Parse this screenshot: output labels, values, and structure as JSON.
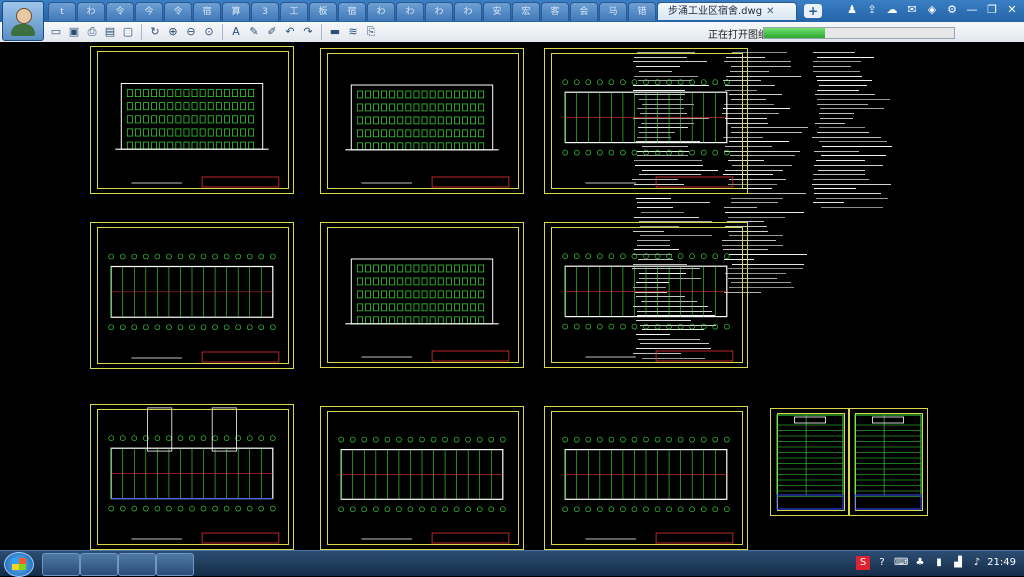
{
  "titlebar": {
    "tabs": [
      "t",
      "わ",
      "令",
      "今",
      "令",
      "宿",
      "算",
      "3",
      "工",
      "板",
      "宿",
      "わ",
      "わ",
      "わ",
      "わ",
      "安",
      "宏",
      "客",
      "会",
      "马",
      "错"
    ],
    "active_tab": "步涌工业区宿舍.dwg",
    "new_tab": "+"
  },
  "toolbar": {
    "status_text": "正在打开图纸",
    "progress": 0.32
  },
  "taskbar": {
    "clock": "21:49"
  },
  "colors": {
    "sheet_border": "#d9d94a",
    "cad_green": "#3ce63c",
    "cad_white": "#ffffff",
    "cad_red": "#e63030",
    "cad_blue": "#3050ff"
  }
}
